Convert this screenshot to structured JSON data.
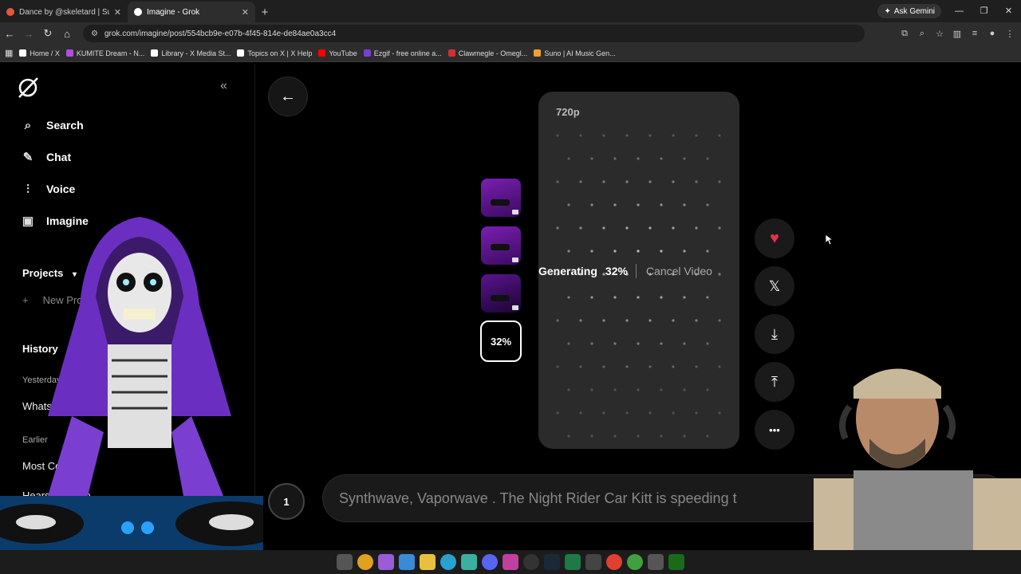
{
  "browser": {
    "tabs": [
      {
        "label": "Dance by @skeletard | Suno",
        "color": "#e8553b",
        "active": false
      },
      {
        "label": "Imagine - Grok",
        "color": "#ffffff",
        "active": true
      }
    ],
    "new_tab": "+",
    "ask_gemini": "Ask Gemini",
    "url": "grok.com/imagine/post/554bcb9e-e07b-4f45-814e-de84ae0a3cc4",
    "bookmarks": [
      {
        "label": "Home / X",
        "color": "#ffffff"
      },
      {
        "label": "KUMITE Dream - N...",
        "color": "#b04fd8"
      },
      {
        "label": "Library - X Media St...",
        "color": "#ffffff"
      },
      {
        "label": "Topics on X | X Help",
        "color": "#ffffff"
      },
      {
        "label": "YouTube",
        "color": "#ff0000"
      },
      {
        "label": "Ezgif - free online a...",
        "color": "#7a3fd0"
      },
      {
        "label": "Clawmegle - Omegl...",
        "color": "#d03030"
      },
      {
        "label": "Suno | AI Music Gen...",
        "color": "#f0a030"
      }
    ]
  },
  "sidebar": {
    "collapse_icon": "«",
    "nav": [
      {
        "label": "Search",
        "icon": "search-icon",
        "glyph": "⌕"
      },
      {
        "label": "Chat",
        "icon": "chat-icon",
        "glyph": "✎"
      },
      {
        "label": "Voice",
        "icon": "voice-icon",
        "glyph": "⫶"
      },
      {
        "label": "Imagine",
        "icon": "imagine-icon",
        "glyph": "▣"
      }
    ],
    "projects_label": "Projects",
    "new_project_label": "New Pro",
    "history_label": "History",
    "yesterday_label": "Yesterday",
    "earlier_label": "Earlier",
    "history_items": [
      "WhatsA",
      "Most Comple",
      "Hearst's Camp"
    ]
  },
  "main": {
    "resolution": "720p",
    "thumbnail_progress": "32%",
    "generating_label": "Generating",
    "generating_percent": "32%",
    "progress_fraction": 0.32,
    "cancel_label": "Cancel Video",
    "actions": [
      {
        "name": "like-button",
        "glyph": "♥",
        "color": "#e0334a"
      },
      {
        "name": "share-x-button",
        "glyph": "𝕏",
        "color": "#ffffff"
      },
      {
        "name": "download-button",
        "glyph": "⤓",
        "color": "#ffffff"
      },
      {
        "name": "upload-button",
        "glyph": "⤒",
        "color": "#ffffff"
      },
      {
        "name": "more-button",
        "glyph": "•••",
        "color": "#ffffff"
      }
    ],
    "prompt_text": "Synthwave, Vaporwave . The Night Rider Car Kitt is speeding t",
    "counter_badge": "1"
  },
  "colors": {
    "accent_purple": "#7a1fb0",
    "heart": "#e0334a"
  }
}
